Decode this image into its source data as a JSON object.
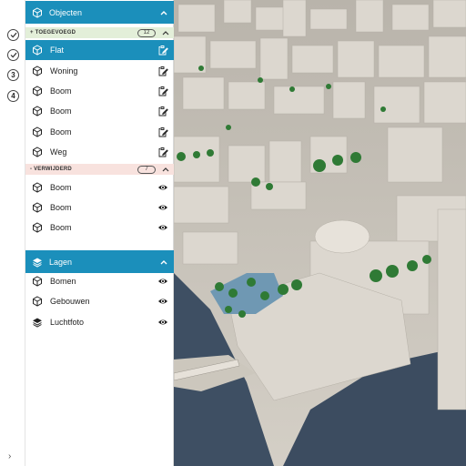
{
  "rail": {
    "steps": [
      {
        "state": "done",
        "label": ""
      },
      {
        "state": "done",
        "label": ""
      },
      {
        "state": "current",
        "label": "3"
      },
      {
        "state": "todo",
        "label": "4"
      }
    ],
    "expand_icon": "chevron-right-icon"
  },
  "objects": {
    "title": "Objecten",
    "icon": "cube-icon",
    "added": {
      "title": "+ TOEGEVOEGD",
      "count": "12",
      "items": [
        {
          "label": "Flat",
          "selected": true
        },
        {
          "label": "Woning",
          "selected": false
        },
        {
          "label": "Boom",
          "selected": false
        },
        {
          "label": "Boom",
          "selected": false
        },
        {
          "label": "Boom",
          "selected": false
        },
        {
          "label": "Weg",
          "selected": false
        }
      ]
    },
    "removed": {
      "title": "- VERWIJDERD",
      "count": "7",
      "items": [
        {
          "label": "Boom"
        },
        {
          "label": "Boom"
        },
        {
          "label": "Boom"
        }
      ]
    }
  },
  "layers": {
    "title": "Lagen",
    "icon": "layers-icon",
    "items": [
      {
        "label": "Bomen",
        "icon": "cube-icon"
      },
      {
        "label": "Gebouwen",
        "icon": "cube-icon"
      },
      {
        "label": "Luchtfoto",
        "icon": "layers-icon"
      }
    ]
  },
  "colors": {
    "header": "#1b8fbb",
    "added_bg": "#e3efd9",
    "removed_bg": "#f8e2de",
    "building": "#dcd7cf",
    "water": "#3e4f63",
    "tree": "#2f7a35"
  }
}
